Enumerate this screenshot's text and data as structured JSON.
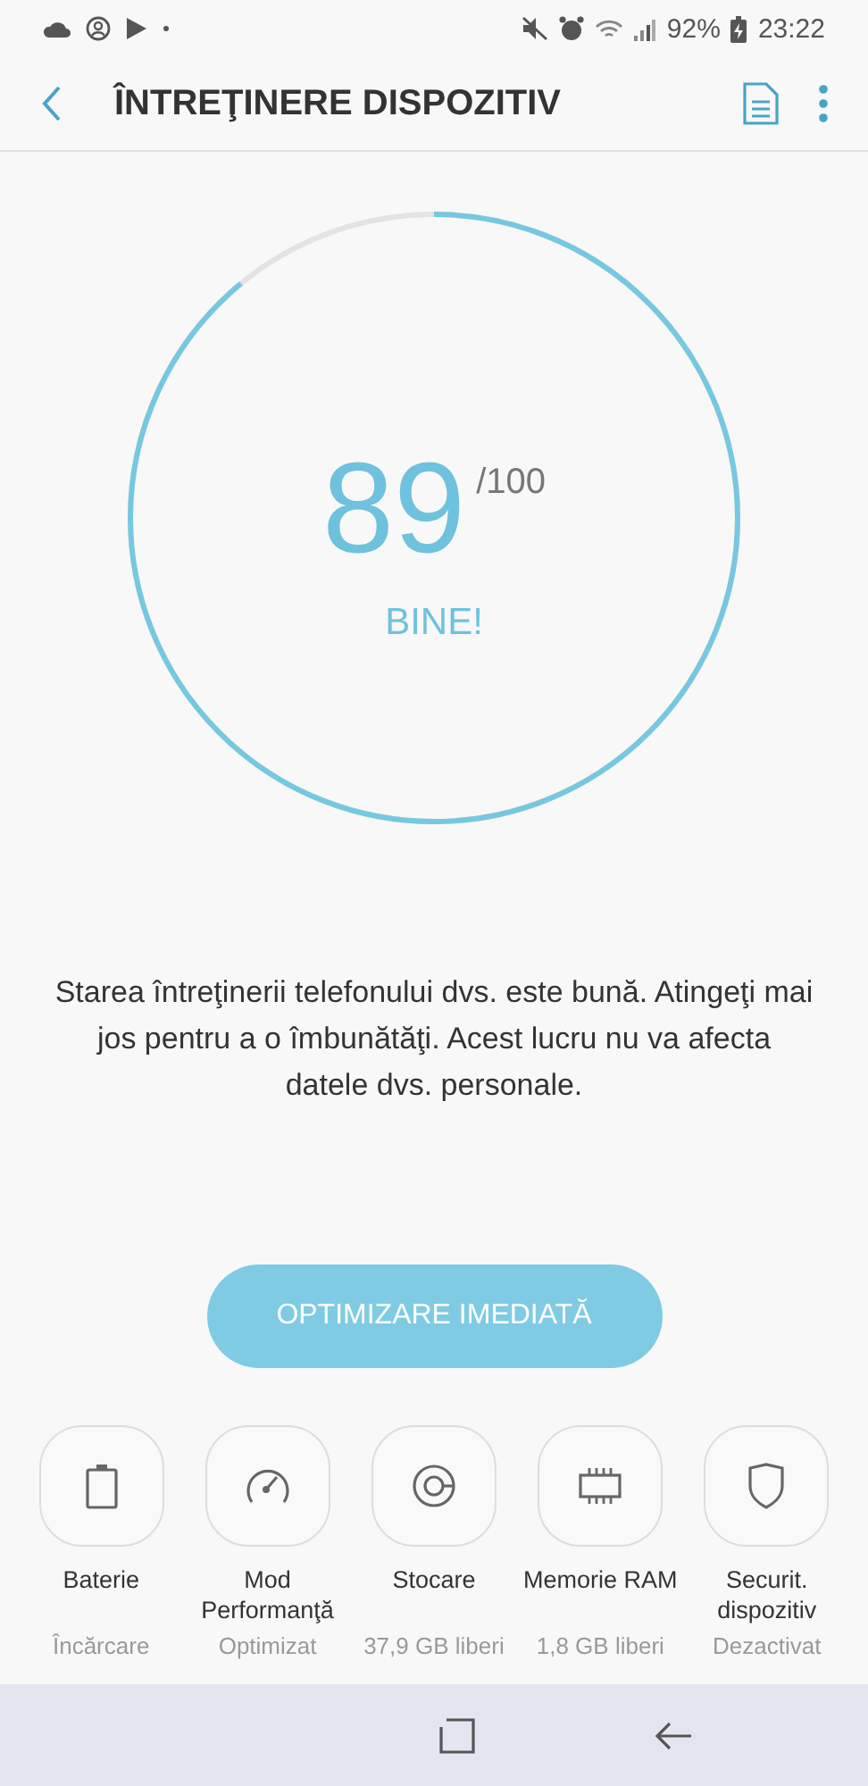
{
  "status_bar": {
    "battery": "92%",
    "time": "23:22"
  },
  "toolbar": {
    "title": "ÎNTREŢINERE DISPOZITIV"
  },
  "score": {
    "value": "89",
    "max": "/100",
    "rating": "BINE!"
  },
  "message": "Starea întreţinerii telefonului dvs. este bună. Atingeţi mai jos pentru a o îmbunătăţi. Acest lucru nu va afecta datele dvs. personale.",
  "optimize_button": "OPTIMIZARE IMEDIATĂ",
  "tiles": [
    {
      "kind": "battery",
      "label": "Baterie",
      "status": "Încărcare"
    },
    {
      "kind": "performance",
      "label": "Mod Performanţă",
      "status": "Optimizat"
    },
    {
      "kind": "storage",
      "label": "Stocare",
      "status": "37,9 GB liberi"
    },
    {
      "kind": "memory",
      "label": "Memorie RAM",
      "status": "1,8 GB liberi"
    },
    {
      "kind": "security",
      "label": "Securit. dispozitiv",
      "status": "Dezactivat"
    }
  ]
}
